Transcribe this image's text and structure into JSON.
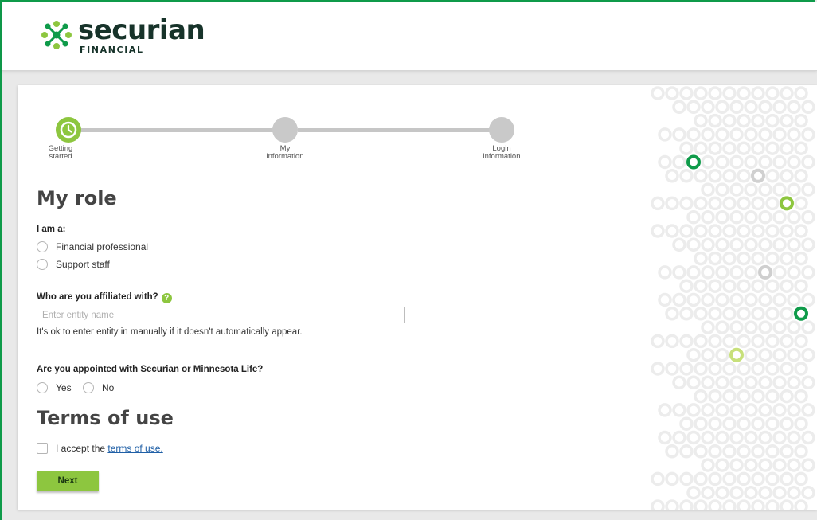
{
  "brand": {
    "name": "securian",
    "subtitle": "FINANCIAL"
  },
  "stepper": {
    "steps": [
      {
        "label_line1": "Getting",
        "label_line2": "started",
        "state": "active"
      },
      {
        "label_line1": "My",
        "label_line2": "information",
        "state": "inactive"
      },
      {
        "label_line1": "Login",
        "label_line2": "information",
        "state": "inactive"
      }
    ]
  },
  "role_section": {
    "title": "My role",
    "question": "I am a:",
    "options": [
      "Financial professional",
      "Support staff"
    ]
  },
  "affiliation": {
    "question": "Who are you affiliated with?",
    "help_icon": "?",
    "placeholder": "Enter entity name",
    "value": "",
    "hint": "It's ok to enter entity in manually if it doesn't automatically appear."
  },
  "appointment": {
    "question": "Are you appointed with Securian or Minnesota Life?",
    "options": [
      "Yes",
      "No"
    ]
  },
  "terms": {
    "title": "Terms of use",
    "checkbox_prefix": "I accept the ",
    "link_text": "terms of use."
  },
  "actions": {
    "next_label": "Next"
  },
  "colors": {
    "accent": "#8dc63f",
    "brand_green": "#0f9b4a",
    "dark_text": "#17332a",
    "link": "#1f5fa6"
  }
}
